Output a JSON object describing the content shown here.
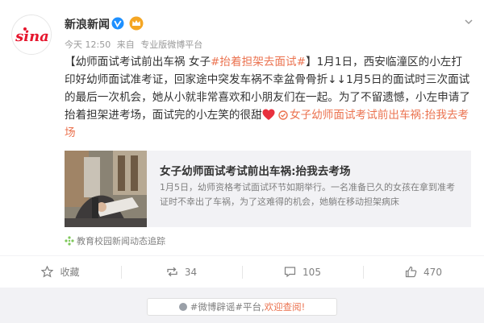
{
  "header": {
    "name": "新浪新闻",
    "time": "今天 12:50",
    "from_label": "来自",
    "platform": "专业版微博平台",
    "logo_text": "sina"
  },
  "post": {
    "open": "【",
    "title_text": "幼师面试考试前出车祸 女子",
    "tag": "#抬着担架去面试#",
    "close": "】",
    "body": "1月1日，西安临潼区的小左打印好幼师面试准考证，回家途中突发车祸不幸盆骨骨折↓↓1月5日的面试时三次面试的最后一次机会，她从小就非常喜欢和小朋友们在一起。为了不留遗憾，小左申请了抬着担架进考场，面试完的小左笑的很甜",
    "topic_link": "女子幼师面试考试前出车祸:抬我去考场"
  },
  "card": {
    "title": "女子幼师面试考试前出车祸:抬我去考场",
    "desc": "1月5日，幼师资格考试面试环节如期举行。一名准备已久的女孩在拿到准考证时不幸出了车祸，为了这难得的机会，她躺在移动担架病床"
  },
  "source": "教育校园新闻动态追踪",
  "actions": {
    "favorite": "收藏",
    "repost": "34",
    "comment": "105",
    "like": "470"
  },
  "footer": {
    "hash": "#微博辟谣#",
    "platform": "平台,",
    "link": "欢迎查阅!"
  },
  "colors": {
    "accent": "#eb7350",
    "verified": "#1e90ff"
  }
}
